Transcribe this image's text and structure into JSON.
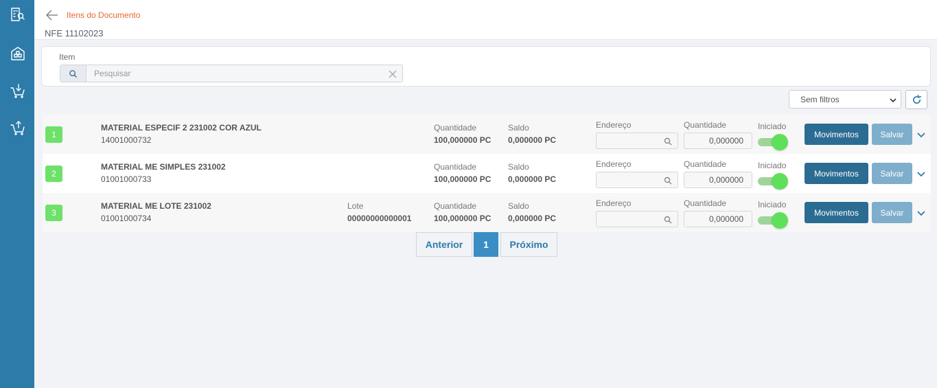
{
  "sidebar": {
    "icons": [
      "building-search-icon",
      "warehouse-icon",
      "cart-download-icon",
      "cart-upload-icon"
    ]
  },
  "header": {
    "breadcrumb": "Itens do Documento",
    "document_title": "NFE 11102023",
    "accent_color": "#e8672d"
  },
  "filter": {
    "label": "Item",
    "search_placeholder": "Pesquisar",
    "search_value": "",
    "select_value": "Sem filtros"
  },
  "rows": [
    {
      "index": "1",
      "name": "MATERIAL ESPECIF 2 231002 COR AZUL",
      "code": "14001000732",
      "lote_label": "",
      "lote_value": "",
      "qty_label": "Quantidade",
      "qty_value": "100,000000 PC",
      "saldo_label": "Saldo",
      "saldo_value": "0,000000 PC",
      "endereco_label": "Endereço",
      "endereco_value": "",
      "qty_input_label": "Quantidade",
      "qty_input_value": "0,000000",
      "iniciado_label": "Iniciado",
      "iniciado": true,
      "btn_movimentos": "Movimentos",
      "btn_salvar": "Salvar"
    },
    {
      "index": "2",
      "name": "MATERIAL ME SIMPLES 231002",
      "code": "01001000733",
      "lote_label": "",
      "lote_value": "",
      "qty_label": "Quantidade",
      "qty_value": "100,000000 PC",
      "saldo_label": "Saldo",
      "saldo_value": "0,000000 PC",
      "endereco_label": "Endereço",
      "endereco_value": "",
      "qty_input_label": "Quantidade",
      "qty_input_value": "0,000000",
      "iniciado_label": "Iniciado",
      "iniciado": true,
      "btn_movimentos": "Movimentos",
      "btn_salvar": "Salvar"
    },
    {
      "index": "3",
      "name": "MATERIAL ME LOTE 231002",
      "code": "01001000734",
      "lote_label": "Lote",
      "lote_value": "00000000000001",
      "qty_label": "Quantidade",
      "qty_value": "100,000000 PC",
      "saldo_label": "Saldo",
      "saldo_value": "0,000000 PC",
      "endereco_label": "Endereço",
      "endereco_value": "",
      "qty_input_label": "Quantidade",
      "qty_input_value": "0,000000",
      "iniciado_label": "Iniciado",
      "iniciado": true,
      "btn_movimentos": "Movimentos",
      "btn_salvar": "Salvar"
    }
  ],
  "pagination": {
    "prev_label": "Anterior",
    "current_page": "1",
    "next_label": "Próximo"
  }
}
